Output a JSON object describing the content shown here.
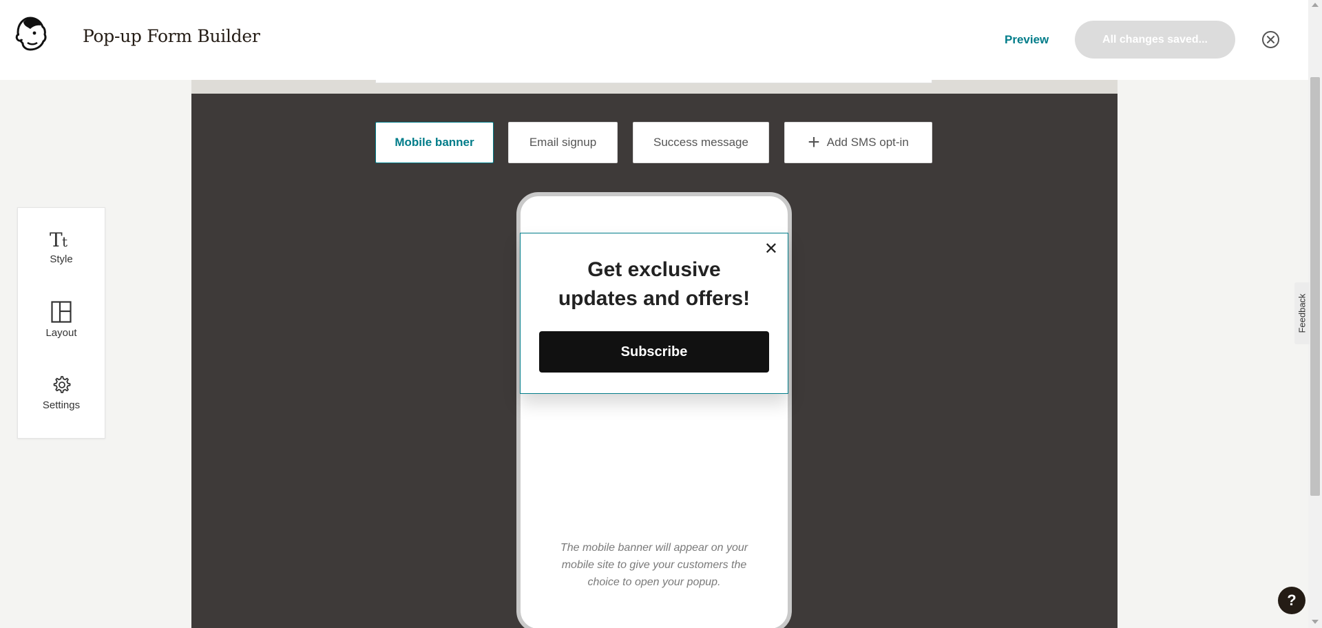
{
  "header": {
    "title": "Pop-up Form Builder",
    "preview_label": "Preview",
    "status_button_label": "All changes saved..."
  },
  "tabs": [
    {
      "label": "Mobile banner",
      "active": true
    },
    {
      "label": "Email signup",
      "active": false
    },
    {
      "label": "Success message",
      "active": false
    },
    {
      "label": "Add SMS opt-in",
      "active": false,
      "icon": "plus-icon"
    }
  ],
  "popup": {
    "heading_line1": "Get exclusive",
    "heading_line2": "updates and offers!",
    "subscribe_label": "Subscribe",
    "close_symbol": "✕"
  },
  "phone_note": {
    "line1": "The mobile banner will appear on your",
    "line2": "mobile site to give your customers the",
    "line3": "choice to open your popup."
  },
  "left_toolbar": {
    "items": [
      {
        "label": "Style",
        "icon": "text-style-icon"
      },
      {
        "label": "Layout",
        "icon": "layout-icon"
      },
      {
        "label": "Settings",
        "icon": "gear-icon"
      }
    ]
  },
  "feedback_label": "Feedback",
  "help_label": "?",
  "colors": {
    "accent": "#007c89",
    "canvas_bg": "#3e3a39",
    "button_dark": "#111111",
    "saved_button_bg": "#dcdcdc"
  }
}
